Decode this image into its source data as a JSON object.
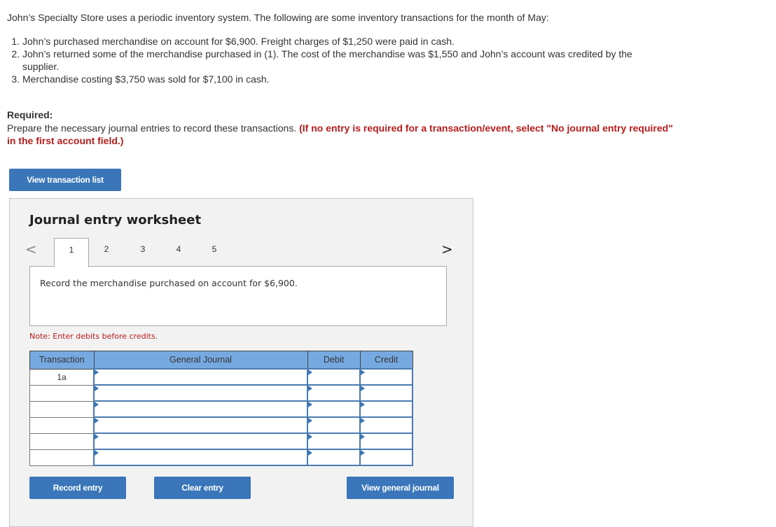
{
  "problem": {
    "intro": "John’s Specialty Store uses a periodic inventory system. The following are some inventory transactions for the month of May:",
    "transactions": [
      {
        "num": "1.",
        "text": "John’s purchased merchandise on account for $6,900. Freight charges of $1,250 were paid in cash."
      },
      {
        "num": "2.",
        "text": "John’s returned some of the merchandise purchased in (1). The cost of the merchandise was $1,550 and John’s account was credited by the supplier."
      },
      {
        "num": "3.",
        "text": "Merchandise costing $3,750 was sold for $7,100 in cash."
      }
    ],
    "required_label": "Required:",
    "required_text": "Prepare the necessary journal entries to record these transactions.",
    "required_note": "(If no entry is required for a transaction/event, select \"No journal entry required\" in the first account field.)"
  },
  "buttons": {
    "view_transaction_list": "View transaction list",
    "record_entry": "Record entry",
    "clear_entry": "Clear entry",
    "view_general_journal": "View general journal"
  },
  "worksheet": {
    "title": "Journal entry worksheet",
    "nav_prev": "<",
    "nav_next": ">",
    "tabs": [
      {
        "label": "1",
        "active": true
      },
      {
        "label": "2",
        "active": false
      },
      {
        "label": "3",
        "active": false
      },
      {
        "label": "4",
        "active": false
      },
      {
        "label": "5",
        "active": false
      }
    ],
    "description": "Record the merchandise purchased on account for $6,900.",
    "note": "Note: Enter debits before credits.",
    "table": {
      "headers": [
        "Transaction",
        "General Journal",
        "Debit",
        "Credit"
      ],
      "rows": [
        {
          "transaction": "1a",
          "account": "",
          "debit": "",
          "credit": ""
        },
        {
          "transaction": "",
          "account": "",
          "debit": "",
          "credit": ""
        },
        {
          "transaction": "",
          "account": "",
          "debit": "",
          "credit": ""
        },
        {
          "transaction": "",
          "account": "",
          "debit": "",
          "credit": ""
        },
        {
          "transaction": "",
          "account": "",
          "debit": "",
          "credit": ""
        },
        {
          "transaction": "",
          "account": "",
          "debit": "",
          "credit": ""
        }
      ]
    }
  },
  "colors": {
    "button_blue": "#3a76b9",
    "header_blue": "#76a9e0",
    "instruction_red": "#b71c1c",
    "panel_gray": "#f2f2f2"
  }
}
